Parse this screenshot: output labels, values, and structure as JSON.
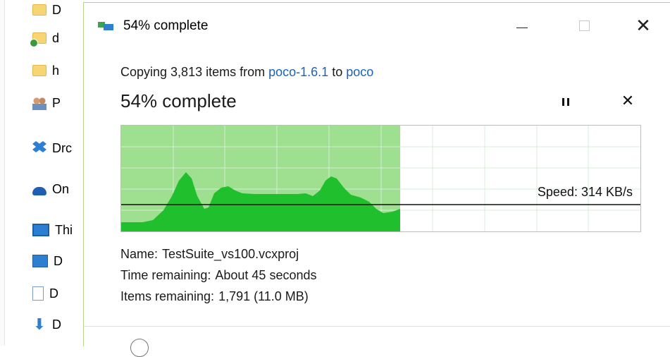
{
  "explorer": {
    "items": [
      {
        "label": "D",
        "icon": "folder-icon"
      },
      {
        "label": "d",
        "icon": "folder-sync-icon"
      },
      {
        "label": "h",
        "icon": "folder-icon"
      },
      {
        "label": "P",
        "icon": "people-icon"
      },
      {
        "label": "Drc",
        "icon": "dropbox-icon"
      },
      {
        "label": "On",
        "icon": "onedrive-icon"
      },
      {
        "label": "Thi",
        "icon": "this-pc-icon"
      },
      {
        "label": "D",
        "icon": "desktop-icon"
      },
      {
        "label": "D",
        "icon": "documents-icon"
      },
      {
        "label": "D",
        "icon": "downloads-icon"
      }
    ]
  },
  "dialog": {
    "title": "54% complete",
    "controls": {
      "close": "✕"
    },
    "copy": {
      "prefix": "Copying 3,813 items from",
      "source": "poco-1.6.1",
      "middle": "to",
      "destination": "poco"
    },
    "heading": "54% complete",
    "progress": 0.54,
    "speed_label": "Speed: 314 KB/s",
    "cancel_glyph": "✕",
    "details": {
      "name_label": "Name:",
      "name_value": "TestSuite_vs100.vcxproj",
      "time_label": "Time remaining:",
      "time_value": "About 45 seconds",
      "items_label": "Items remaining:",
      "items_value": "1,791 (11.0 MB)"
    },
    "colors": {
      "progress_fill": "#9ee08f",
      "speed_area": "#1fbf2e",
      "grid": "#d8ecd8",
      "link": "#1a63b8"
    }
  }
}
